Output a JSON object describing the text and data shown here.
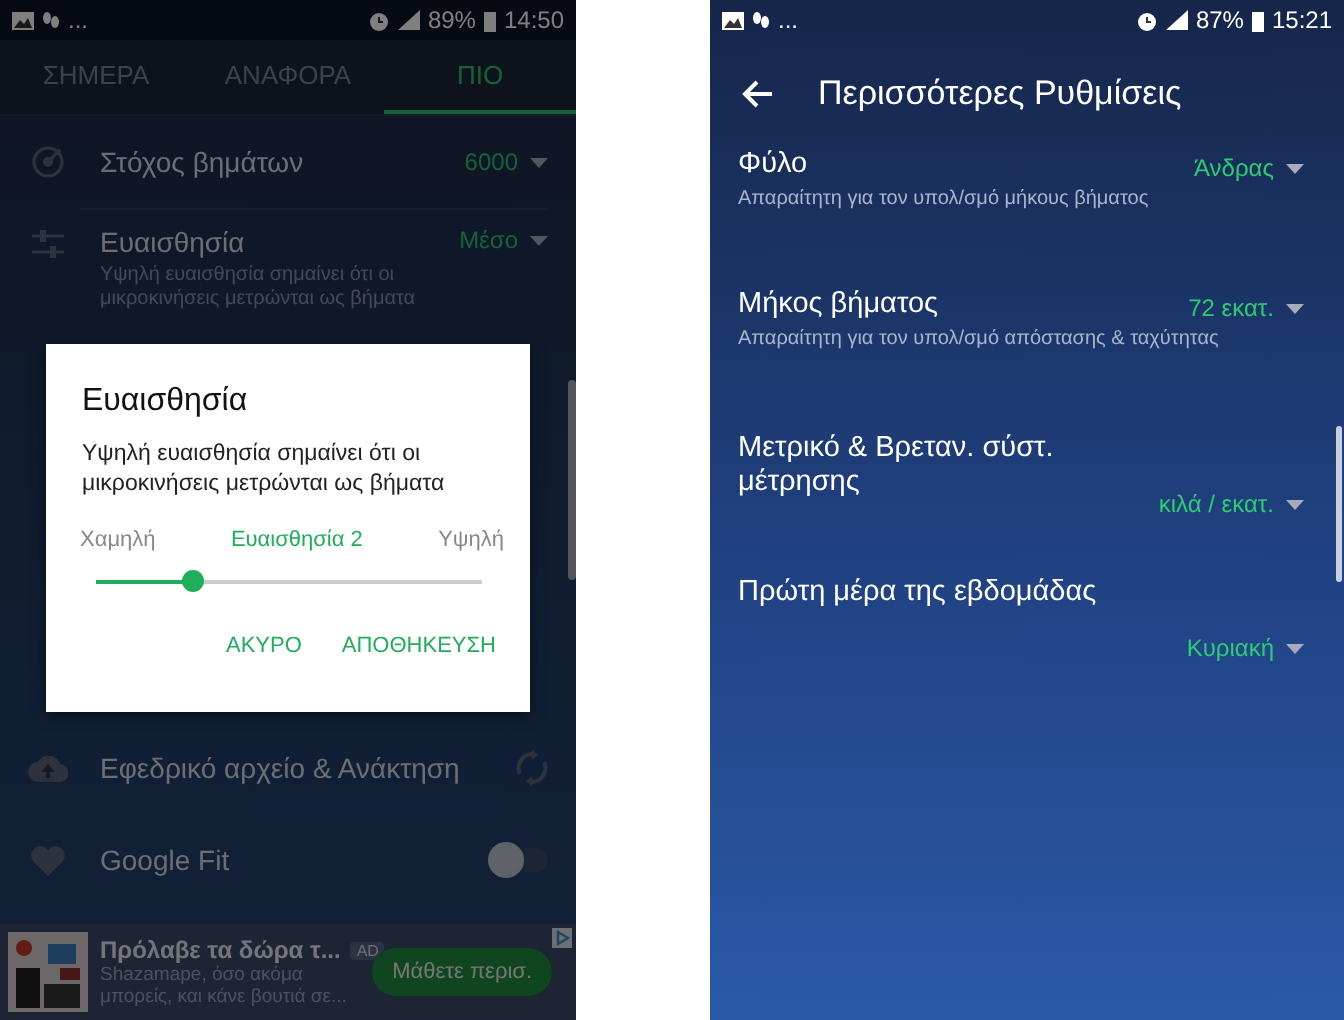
{
  "left_phone": {
    "status_bar": {
      "more": "...",
      "battery": "89%",
      "time": "14:50"
    },
    "tabs": [
      {
        "label": "ΣΗΜΕΡΑ",
        "selected": false
      },
      {
        "label": "ΑΝΑΦΟΡΑ",
        "selected": false
      },
      {
        "label": "ΠΙΟ",
        "selected": true
      }
    ],
    "settings": [
      {
        "kind": "dropdown",
        "title": "Στόχος βημάτων",
        "value": "6000"
      },
      {
        "kind": "dropdown",
        "title": "Ευαισθησία",
        "subtitle": "Υψηλή ευαισθησία σημαίνει ότι οι μικροκινήσεις μετρώνται ως βήματα",
        "value": "Μέσο"
      },
      {
        "kind": "action",
        "title": "Εφεδρικό αρχείο & Ανάκτηση"
      },
      {
        "kind": "toggle",
        "title": "Google Fit",
        "on": false
      }
    ],
    "dialog": {
      "title": "Ευαισθησία",
      "message": "Υψηλή ευαισθησία σημαίνει ότι οι μικροκινήσεις μετρώνται ως βήματα",
      "slider": {
        "low_label": "Χαμηλή",
        "value_label": "Ευαισθησία 2",
        "high_label": "Υψηλή",
        "level": 0.25
      },
      "buttons": [
        "ΑΚΥΡΟ",
        "ΑΠΟΘΗΚΕΥΣΗ"
      ]
    },
    "ad": {
      "title": "Πρόλαβε τα δώρα τ...",
      "badge": "AD",
      "text": "Shazamape, όσο ακόμα μπορείς, και κάνε βουτιά σε...",
      "button": "Μάθετε περισ."
    }
  },
  "right_phone": {
    "status_bar": {
      "more": "...",
      "battery": "87%",
      "time": "15:21"
    },
    "title": "Περισσότερες Ρυθμίσεις",
    "settings": [
      {
        "title": "Φύλο",
        "subtitle": "Απαραίτητη για τον υπολ/σμό μήκους βήματος",
        "value": "Άνδρας"
      },
      {
        "title": "Μήκος βήματος",
        "subtitle": "Απαραίτητη για τον υπολ/σμό απόστασης & ταχύτητας",
        "value": "72 εκατ."
      },
      {
        "title": "Μετρικό & Βρεταν. σύστ. μέτρησης",
        "value": "κιλά / εκατ."
      },
      {
        "title": "Πρώτη μέρα της εβδομάδας",
        "value": "Κυριακή"
      }
    ]
  }
}
